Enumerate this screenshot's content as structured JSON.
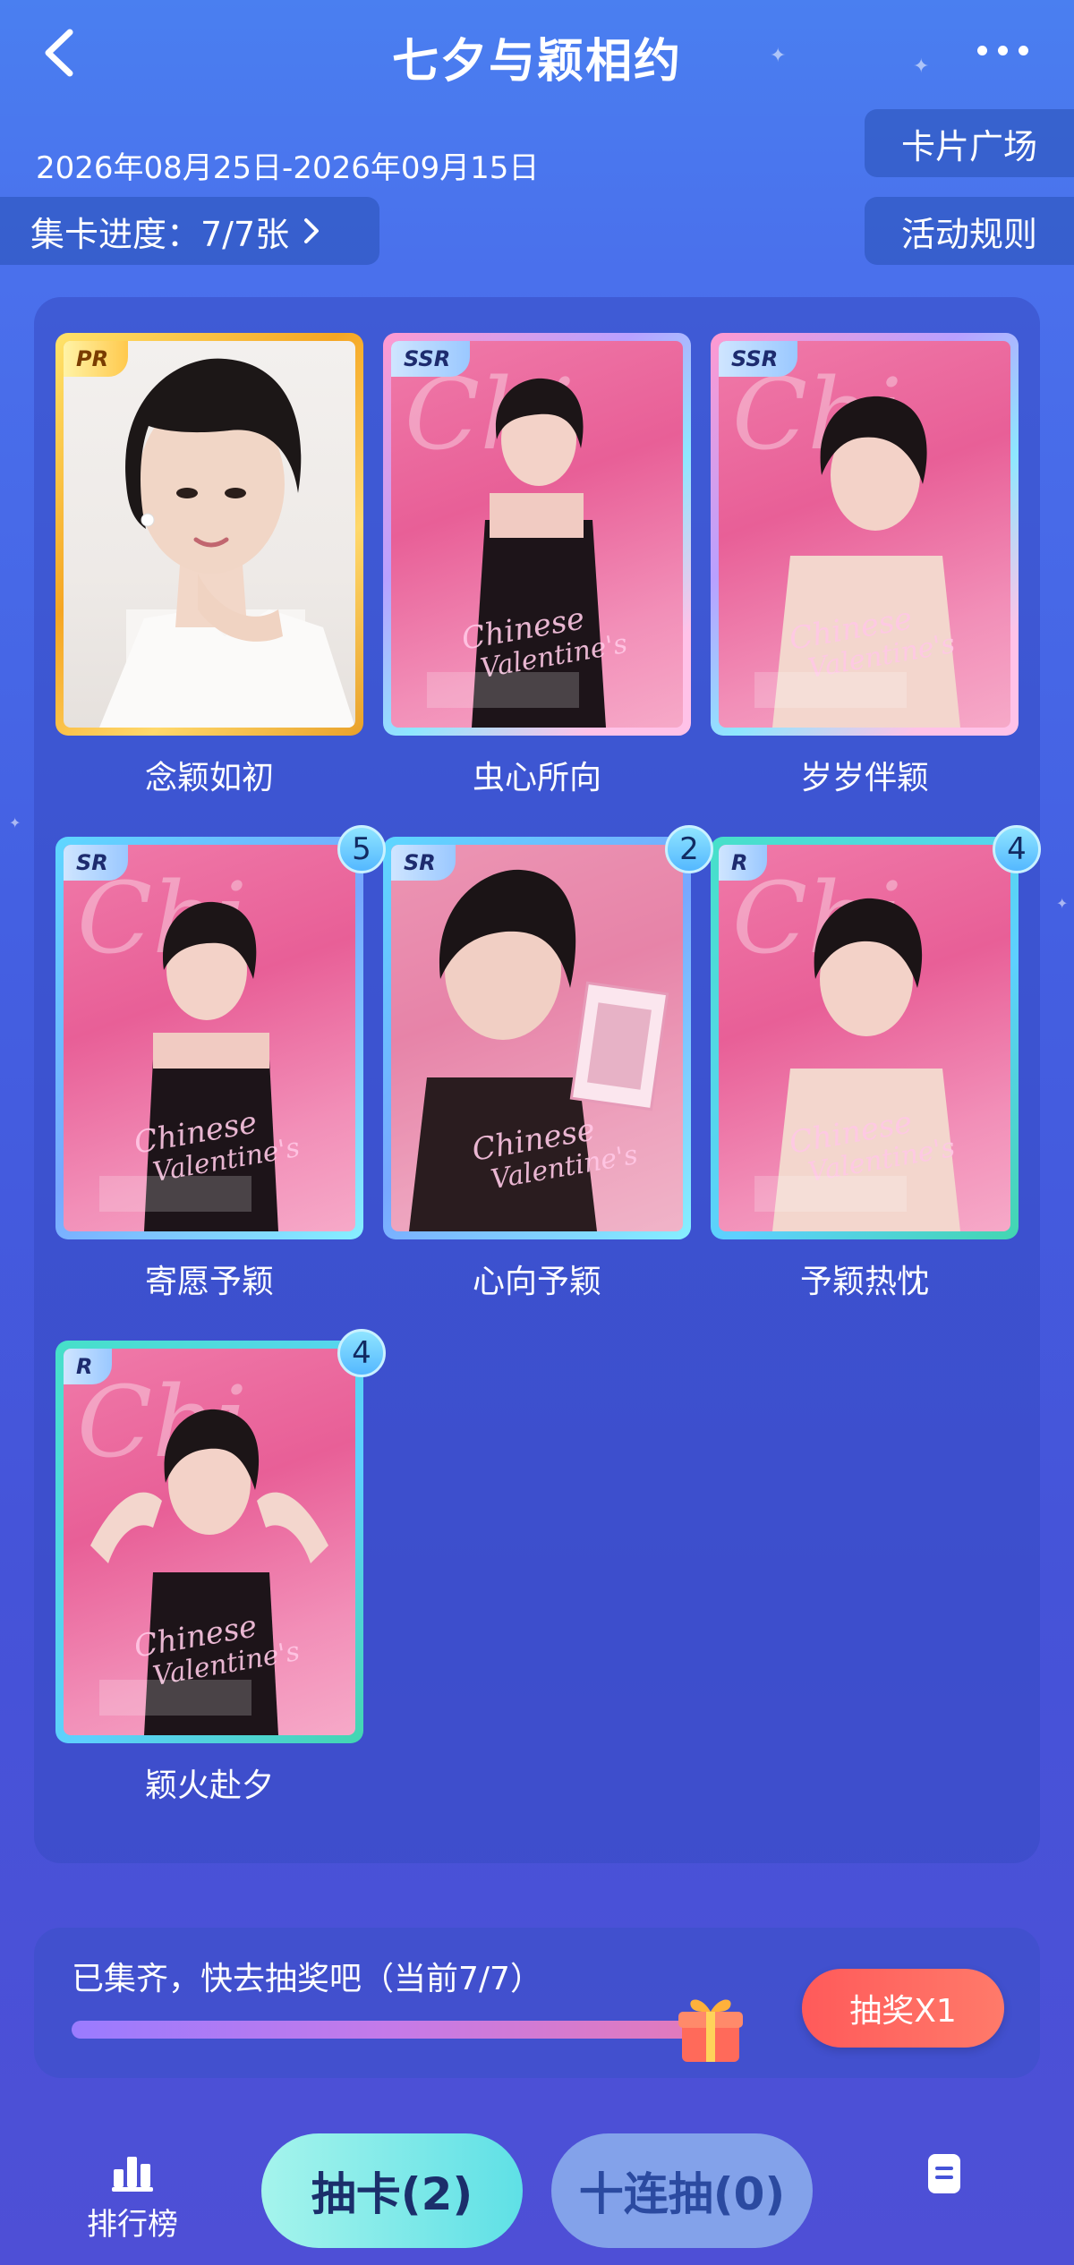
{
  "header": {
    "title": "七夕与颖相约"
  },
  "event": {
    "date_range": "2026年08月25日-2026年09月15日",
    "progress_label": "集卡进度：7/7张",
    "card_square_label": "卡片广场",
    "rules_label": "活动规则"
  },
  "cards": [
    {
      "name": "念颖如初",
      "rarity": "PR",
      "count": null
    },
    {
      "name": "虫心所向",
      "rarity": "SSR",
      "count": null
    },
    {
      "name": "岁岁伴颖",
      "rarity": "SSR",
      "count": null
    },
    {
      "name": "寄愿予颖",
      "rarity": "SR",
      "count": "5"
    },
    {
      "name": "心向予颖",
      "rarity": "SR",
      "count": "2"
    },
    {
      "name": "予颖热忱",
      "rarity": "R",
      "count": "4"
    },
    {
      "name": "颖火赴夕",
      "rarity": "R",
      "count": "4"
    }
  ],
  "lottery": {
    "status_text": "已集齐，快去抽奖吧（当前7/7）",
    "progress_fraction": 1.0,
    "draw_button_label": "抽奖X1"
  },
  "bottom_nav": {
    "rank_label": "排行榜",
    "draw_card_label": "抽卡(2)",
    "ten_draw_label": "十连抽(0)"
  },
  "colors": {
    "draw_card_button": "#5fe0e6",
    "lottery_button": "#ff5a5a",
    "pr_frame": "#f5a623",
    "ssr_frame": "#b9a0ff",
    "sr_frame": "#5ed7ff",
    "r_frame": "#46e0c8"
  }
}
